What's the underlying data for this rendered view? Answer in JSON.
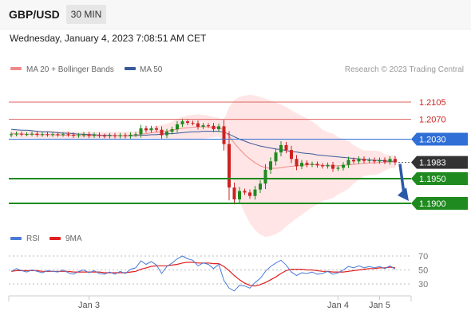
{
  "header": {
    "symbol": "GBP/USD",
    "timeframe": "30 MIN",
    "datetime": "Wednesday, January 4, 2023 7:08:51 AM CET",
    "copyright": "Research © 2023 Trading Central"
  },
  "colors": {
    "resistance": "#e06060",
    "current": "#2f6fd6",
    "support": "#1f8a1f",
    "price_tag": "#333333",
    "ma20": "#f08a8a",
    "band_fill": "#ffdcdc",
    "ma50": "#3a5a99",
    "candle_up": "#1f8a1f",
    "candle_down": "#cc2222",
    "rsi": "#4a7bd6",
    "rsi_ma": "#e02020",
    "arrow": "#2a5aa8"
  },
  "chart_data": [
    {
      "type": "candlestick",
      "legend": [
        {
          "name": "MA 20 + Bollinger Bands",
          "color": "#f08a8a"
        },
        {
          "name": "MA 50",
          "color": "#3a5a99"
        }
      ],
      "price_levels": [
        {
          "label": "1.2105",
          "value": 1.2105,
          "kind": "resistance"
        },
        {
          "label": "1.2070",
          "value": 1.207,
          "kind": "resistance"
        },
        {
          "label": "1.2030",
          "value": 1.203,
          "kind": "current"
        },
        {
          "label": "1.1983",
          "value": 1.1983,
          "kind": "last"
        },
        {
          "label": "1.1950",
          "value": 1.195,
          "kind": "support"
        },
        {
          "label": "1.1900",
          "value": 1.19,
          "kind": "support"
        }
      ],
      "x_ticks": [
        {
          "label": "Jan 3",
          "index": 15
        },
        {
          "label": "Jan 4",
          "index": 63
        },
        {
          "label": "Jan 5",
          "index": 71
        }
      ],
      "projection": {
        "from": 1.1983,
        "to": 1.19,
        "direction": "down"
      },
      "close": [
        1.204,
        1.2041,
        1.204,
        1.204,
        1.2041,
        1.2039,
        1.204,
        1.2039,
        1.204,
        1.2039,
        1.204,
        1.2039,
        1.2037,
        1.2038,
        1.204,
        1.2037,
        1.2039,
        1.2037,
        1.2036,
        1.2038,
        1.2036,
        1.2038,
        1.2036,
        1.2039,
        1.204,
        1.2052,
        1.2048,
        1.2052,
        1.2049,
        1.2038,
        1.2045,
        1.205,
        1.206,
        1.2066,
        1.2063,
        1.2062,
        1.2055,
        1.2058,
        1.2057,
        1.205,
        1.2056,
        1.202,
        1.1932,
        1.1908,
        1.1925,
        1.1922,
        1.1915,
        1.1928,
        1.194,
        1.1968,
        1.1985,
        1.2003,
        1.2018,
        1.2008,
        1.199,
        1.1975,
        1.1982,
        1.1978,
        1.198,
        1.1977,
        1.1975,
        1.1978,
        1.197,
        1.1972,
        1.1978,
        1.1988,
        1.1985,
        1.199,
        1.1986,
        1.1988,
        1.1985,
        1.1988,
        1.1984,
        1.199,
        1.1983
      ],
      "ma20": [
        1.2041,
        1.2041,
        1.204,
        1.204,
        1.204,
        1.2039,
        1.2039,
        1.2039,
        1.2039,
        1.2038,
        1.2038,
        1.2038,
        1.2038,
        1.2037,
        1.2037,
        1.2037,
        1.2037,
        1.2037,
        1.2037,
        1.2037,
        1.2037,
        1.2037,
        1.2037,
        1.2038,
        1.2038,
        1.204,
        1.2041,
        1.2043,
        1.2044,
        1.2045,
        1.2046,
        1.2048,
        1.205,
        1.2052,
        1.2053,
        1.2054,
        1.2055,
        1.2055,
        1.2055,
        1.2054,
        1.2054,
        1.2048,
        1.2036,
        1.2022,
        1.201,
        1.1999,
        1.199,
        1.1982,
        1.1976,
        1.1972,
        1.1971,
        1.1971,
        1.1972,
        1.1974,
        1.1975,
        1.1976,
        1.1977,
        1.1978,
        1.1979,
        1.1978,
        1.1977,
        1.1976,
        1.1976,
        1.1976,
        1.1977,
        1.1978,
        1.1979,
        1.198,
        1.1981,
        1.1982,
        1.1982,
        1.1983,
        1.1983,
        1.1984,
        1.1984
      ],
      "ma50": [
        1.205,
        1.2049,
        1.2048,
        1.2048,
        1.2047,
        1.2046,
        1.2045,
        1.2045,
        1.2044,
        1.2043,
        1.2042,
        1.2042,
        1.2041,
        1.204,
        1.204,
        1.2039,
        1.2039,
        1.2038,
        1.2038,
        1.2038,
        1.2037,
        1.2037,
        1.2037,
        1.2037,
        1.2037,
        1.2038,
        1.2038,
        1.2039,
        1.2039,
        1.204,
        1.2041,
        1.2041,
        1.2042,
        1.2043,
        1.2044,
        1.2045,
        1.2045,
        1.2046,
        1.2046,
        1.2046,
        1.2046,
        1.2044,
        1.204,
        1.2035,
        1.203,
        1.2026,
        1.2022,
        1.2019,
        1.2016,
        1.2014,
        1.2012,
        1.201,
        1.2009,
        1.2007,
        1.2005,
        1.2004,
        1.2002,
        1.2001,
        1.2,
        1.1998,
        1.1997,
        1.1996,
        1.1995,
        1.1994,
        1.1993,
        1.1992,
        1.1991,
        1.199,
        1.1989,
        1.1988,
        1.1987,
        1.1987,
        1.1986,
        1.1985,
        1.1985
      ]
    },
    {
      "type": "line",
      "legend": [
        {
          "name": "RSI",
          "color": "#4a7bd6"
        },
        {
          "name": "9MA",
          "color": "#e02020"
        }
      ],
      "y_ticks": [
        70,
        50,
        30
      ],
      "ylim": [
        20,
        80
      ],
      "rsi": [
        48,
        52,
        49,
        47,
        50,
        48,
        46,
        49,
        48,
        47,
        50,
        46,
        44,
        48,
        50,
        46,
        49,
        45,
        44,
        47,
        44,
        48,
        45,
        51,
        53,
        63,
        58,
        62,
        57,
        45,
        55,
        60,
        66,
        70,
        66,
        64,
        56,
        60,
        58,
        52,
        58,
        35,
        24,
        20,
        28,
        27,
        24,
        32,
        38,
        48,
        55,
        60,
        64,
        57,
        47,
        42,
        46,
        45,
        47,
        44,
        45,
        48,
        44,
        46,
        50,
        55,
        53,
        56,
        53,
        55,
        53,
        55,
        52,
        56,
        51
      ],
      "rsi_ma": [
        48,
        49,
        49,
        49,
        49,
        49,
        48,
        48,
        48,
        48,
        48,
        48,
        47,
        47,
        47,
        47,
        47,
        47,
        46,
        46,
        46,
        46,
        46,
        47,
        48,
        51,
        53,
        55,
        56,
        56,
        56,
        57,
        58,
        60,
        61,
        61,
        60,
        60,
        60,
        59,
        59,
        55,
        49,
        42,
        36,
        31,
        28,
        27,
        29,
        32,
        36,
        40,
        45,
        49,
        51,
        51,
        51,
        50,
        50,
        49,
        48,
        48,
        47,
        47,
        47,
        48,
        49,
        50,
        51,
        52,
        52,
        53,
        53,
        54,
        53
      ]
    }
  ]
}
